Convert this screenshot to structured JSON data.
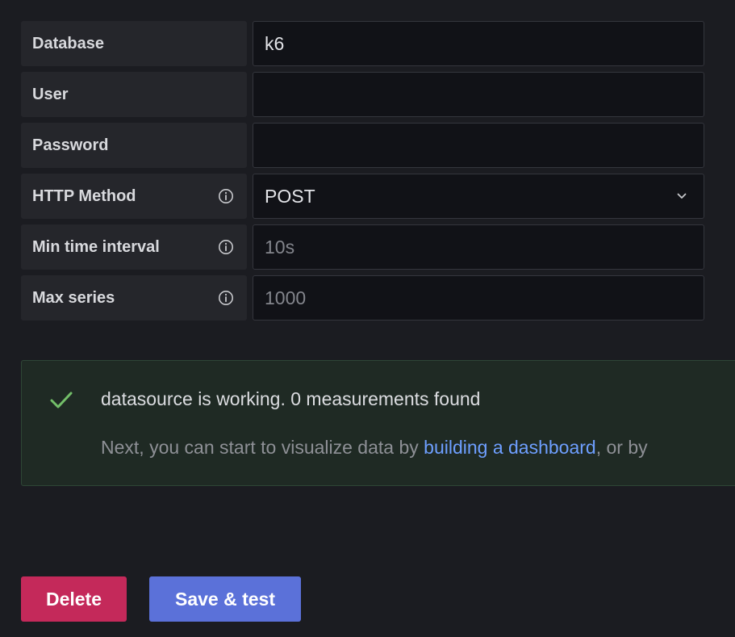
{
  "fields": [
    {
      "label": "Database",
      "value": "k6",
      "placeholder": "",
      "has_info": false,
      "type": "input"
    },
    {
      "label": "User",
      "value": "",
      "placeholder": "",
      "has_info": false,
      "type": "input"
    },
    {
      "label": "Password",
      "value": "",
      "placeholder": "",
      "has_info": false,
      "type": "password"
    },
    {
      "label": "HTTP Method",
      "value": "POST",
      "placeholder": "",
      "has_info": true,
      "type": "select"
    },
    {
      "label": "Min time interval",
      "value": "",
      "placeholder": "10s",
      "has_info": true,
      "type": "input"
    },
    {
      "label": "Max series",
      "value": "",
      "placeholder": "1000",
      "has_info": true,
      "type": "input"
    }
  ],
  "alert": {
    "title": "datasource is working. 0 measurements found",
    "body_prefix": "Next, you can start to visualize data by ",
    "link_text": "building a dashboard",
    "body_suffix": ", or by",
    "status_color": "#73bf69",
    "icon": "check-icon"
  },
  "buttons": {
    "delete_label": "Delete",
    "save_label": "Save & test"
  },
  "colors": {
    "background": "#1b1c21",
    "label_bg": "#25262b",
    "input_bg": "#111217",
    "delete": "#c4295a",
    "primary": "#5b71d9",
    "link": "#6e9fff"
  }
}
